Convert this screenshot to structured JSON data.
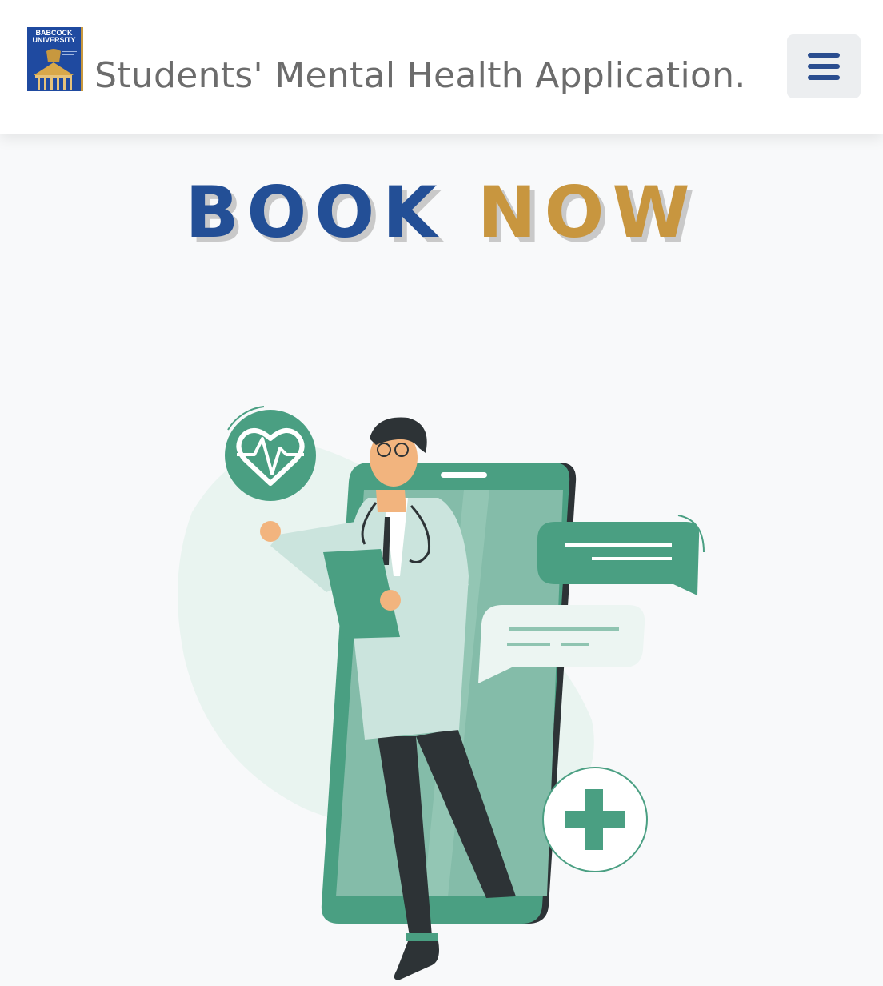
{
  "navbar": {
    "logo_line1": "BABCOCK",
    "logo_line2": "UNIVERSITY",
    "brand_title": "Students' Mental Health Application.",
    "menu_icon": "hamburger-menu-icon"
  },
  "hero": {
    "heading_word1": "BOOK",
    "heading_word2": "NOW",
    "illustration": "doctor-with-smartphone-illustration"
  },
  "colors": {
    "primary_blue": "#234f96",
    "accent_gold": "#c8963f",
    "illustration_green": "#4a9f82"
  }
}
